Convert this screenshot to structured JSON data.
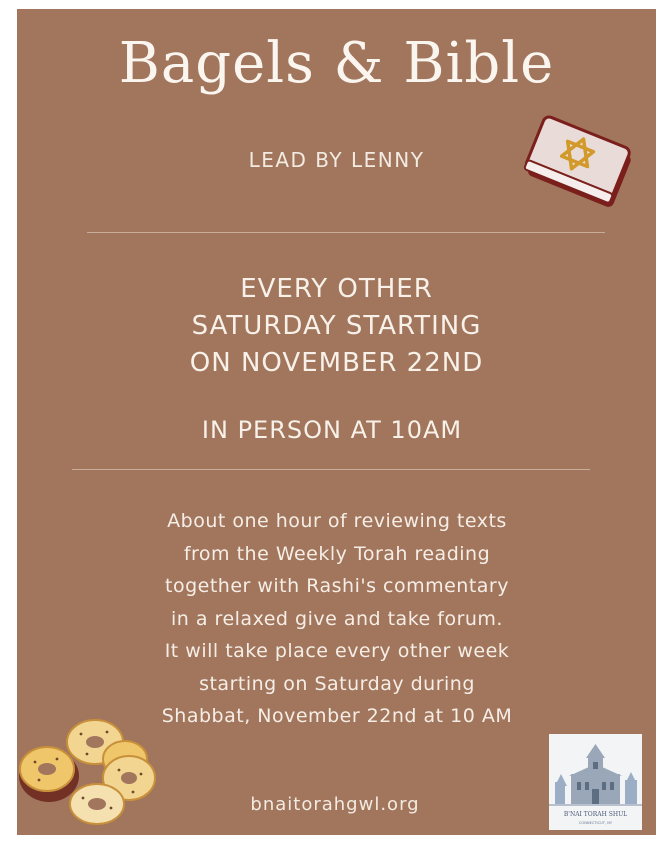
{
  "flyer": {
    "title": "Bagels & Bible",
    "leader": "LEAD BY LENNY",
    "schedule": {
      "lines": [
        "EVERY OTHER",
        "SATURDAY STARTING",
        "ON NOVEMBER 22ND"
      ]
    },
    "in_person": "IN PERSON AT 10AM",
    "description": {
      "lines": [
        "About one hour of reviewing texts",
        "from the Weekly Torah reading",
        "together with Rashi's commentary",
        "in a relaxed give and take forum.",
        "It will  take place every other week",
        "starting on Saturday during",
        "Shabbat, November 22nd at 10 AM"
      ]
    },
    "website": "bnaitorahgwl.org",
    "logo": {
      "name": "B'NAI TORAH SHUL",
      "sub": "CONNECTICUT, NY"
    },
    "icons": {
      "bible": "bible-star-of-david-icon",
      "bagels": "bagels-illustration",
      "logo": "synagogue-building-logo"
    },
    "colors": {
      "background": "#a1765d",
      "text": "#f8f1e9",
      "star": "#d19a2a",
      "book": "#e9dbd8",
      "book_edge": "#7a1f1b"
    }
  }
}
